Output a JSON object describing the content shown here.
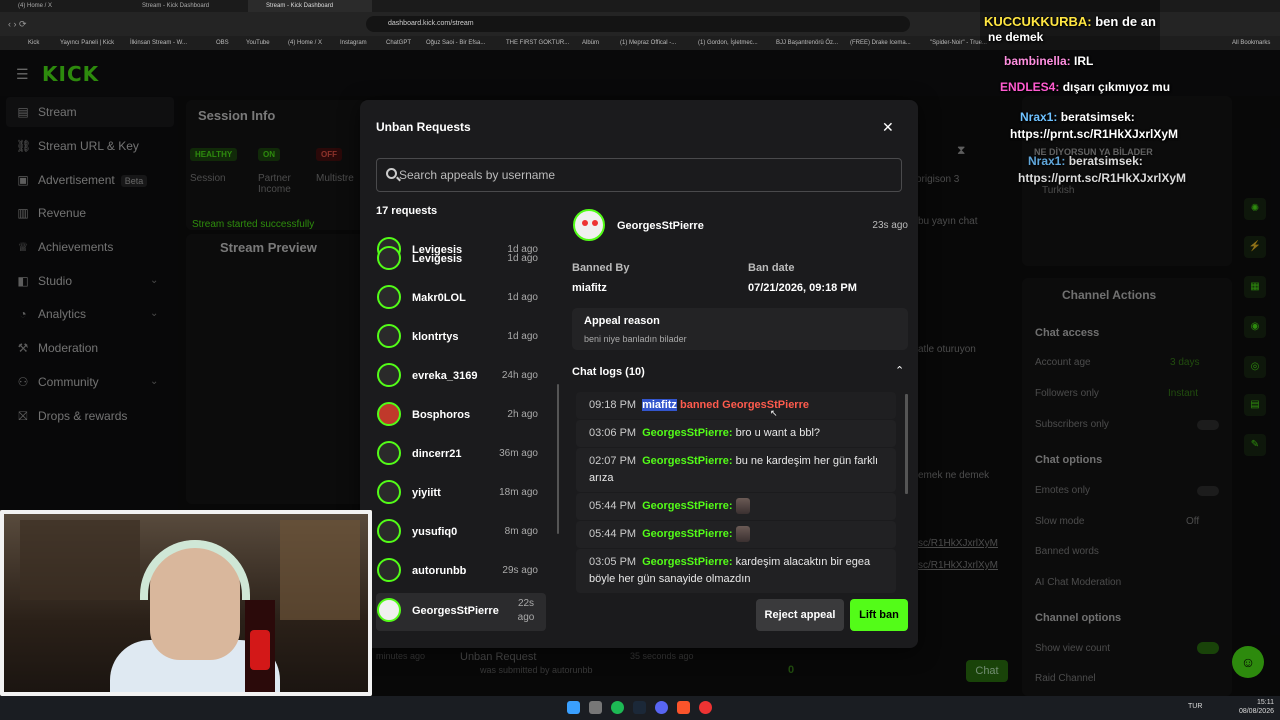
{
  "browser": {
    "tabs": [
      {
        "label": "(4) Home / X",
        "active": false
      },
      {
        "label": "Stream - Kick Dashboard",
        "active": false
      },
      {
        "label": "Stream - Kick Dashboard",
        "active": true
      }
    ],
    "url": "dashboard.kick.com/stream",
    "bookmarks": [
      "Kick",
      "Yayıncı Paneli | Kick",
      "İlkinsan Stream - W...",
      "OBS",
      "YouTube",
      "(4) Home / X",
      "Instagram",
      "ChatGPT",
      "Oğuz Saoi - Bir Efsa...",
      "THE FIRST GOKTUR...",
      "Albüm",
      "(1) Mepraz Offical -...",
      "(1) Gordon, İşletmec...",
      "BJJ Başantrenörü Öz...",
      "(FREE) Drake Icema...",
      "\"Spider-Noir\" - True..."
    ],
    "all_bookmarks": "All Bookmarks"
  },
  "dashboard": {
    "logo": "KICK",
    "sidebar": [
      {
        "label": "Stream",
        "icon": "stream-icon",
        "active": true
      },
      {
        "label": "Stream URL & Key",
        "icon": "link-icon"
      },
      {
        "label": "Advertisement",
        "icon": "ad-icon",
        "badge": "Beta"
      },
      {
        "label": "Revenue",
        "icon": "revenue-icon"
      },
      {
        "label": "Achievements",
        "icon": "trophy-icon"
      },
      {
        "label": "Studio",
        "icon": "studio-icon",
        "expandable": true
      },
      {
        "label": "Analytics",
        "icon": "analytics-icon",
        "expandable": true
      },
      {
        "label": "Moderation",
        "icon": "shield-icon"
      },
      {
        "label": "Community",
        "icon": "community-icon",
        "expandable": true
      },
      {
        "label": "Drops & rewards",
        "icon": "gift-icon"
      }
    ],
    "session_info": {
      "title": "Session Info",
      "badges": [
        "HEALTHY",
        "ON",
        "OFF"
      ],
      "labels": [
        "Session",
        "Partner Income",
        "Multistre"
      ],
      "stream_started": "Stream started successfully"
    },
    "stream_preview_title": "Stream Preview",
    "channel_actions": {
      "title": "Channel Actions",
      "chat_access": "Chat access",
      "account_age": {
        "label": "Account age",
        "value": "3 days"
      },
      "followers_only": {
        "label": "Followers only",
        "value": "Instant"
      },
      "subscribers_only": "Subscribers only",
      "chat_options": "Chat options",
      "emotes_only": "Emotes only",
      "slow_mode": {
        "label": "Slow mode",
        "value": "Off"
      },
      "banned_words": "Banned words",
      "ai_moderation": "AI Chat Moderation",
      "channel_options": "Channel options",
      "show_view_count": "Show view count",
      "raid_channel": "Raid Channel"
    },
    "bottom": {
      "unban_request": "Unban Request",
      "submitted_by": "was submitted by autorunbb",
      "submitted_ago": "35 seconds ago",
      "minutes_ago": "minutes ago",
      "viewer_count": "0",
      "chat_button": "Chat"
    },
    "chat_fragments": {
      "origin": "origison 3",
      "line1": "bu yayın chat",
      "line2": "atle oturuyon",
      "line3": "emek ne demek",
      "link1": "sc/R1HkXJxrlXyM",
      "link2": "sc/R1HkXJxrlXyM",
      "turkish": "Turkish"
    }
  },
  "overlay_chat": [
    {
      "user": "KUCCUKKURBA:",
      "text": "ben de an"
    },
    {
      "user": "",
      "text": "ne demek"
    },
    {
      "user": "bambinella:",
      "text": "IRL"
    },
    {
      "user": "ENDLES4:",
      "text": "dışarı çıkmıyoz mu"
    },
    {
      "user": "Nrax1:",
      "text": "beratsimsek:"
    },
    {
      "user": "",
      "text": "https://prnt.sc/R1HkXJxrlXyM"
    },
    {
      "user": "",
      "text": "NE DİYORSUN YA BİLADER"
    },
    {
      "user": "Nrax1:",
      "text": "beratsimsek:"
    },
    {
      "user": "",
      "text": "https://prnt.sc/R1HkXJxrlXyM"
    }
  ],
  "modal": {
    "title": "Unban Requests",
    "search_placeholder": "Search appeals by username",
    "requests_count": "17 requests",
    "requests": [
      {
        "name": "Levigesis",
        "time": "1d ago"
      },
      {
        "name": "Makr0LOL",
        "time": "1d ago"
      },
      {
        "name": "klontrtys",
        "time": "1d ago"
      },
      {
        "name": "evreka_3169",
        "time": "24h ago"
      },
      {
        "name": "Bosphoros",
        "time": "2h ago"
      },
      {
        "name": "dincerr21",
        "time": "36m ago"
      },
      {
        "name": "yiyiitt",
        "time": "18m ago"
      },
      {
        "name": "yusufiq0",
        "time": "8m ago"
      },
      {
        "name": "autorunbb",
        "time": "29s ago"
      },
      {
        "name": "GeorgesStPierre",
        "time": "22s ago",
        "selected": true
      }
    ],
    "detail": {
      "username": "GeorgesStPierre",
      "time": "23s ago",
      "banned_by_label": "Banned By",
      "banned_by": "miafitz",
      "ban_date_label": "Ban date",
      "ban_date": "07/21/2026, 09:18 PM",
      "appeal_reason_label": "Appeal reason",
      "appeal_reason": "beni niye banladın bilader",
      "chat_logs_label": "Chat logs (10)",
      "logs": [
        {
          "time": "09:18 PM",
          "user": "miafitz",
          "action": "banned GeorgesStPierre"
        },
        {
          "time": "03:06 PM",
          "user": "GeorgesStPierre:",
          "text": "bro u want a bbl?"
        },
        {
          "time": "02:07 PM",
          "user": "GeorgesStPierre:",
          "text": "bu ne kardeşim her gün farklı arıza"
        },
        {
          "time": "05:44 PM",
          "user": "GeorgesStPierre:",
          "text": ""
        },
        {
          "time": "05:44 PM",
          "user": "GeorgesStPierre:",
          "text": ""
        },
        {
          "time": "03:05 PM",
          "user": "GeorgesStPierre:",
          "text": "kardeşim alacaktın bir egea böyle her gün sanayide olmazdın"
        }
      ]
    },
    "reject_label": "Reject appeal",
    "lift_label": "Lift ban"
  },
  "taskbar": {
    "lang": "TUR",
    "time": "15:11",
    "date": "08/08/2026"
  },
  "colors": {
    "accent": "#53fc18",
    "danger": "#ff5b4d",
    "panel": "#1b1b1d"
  }
}
